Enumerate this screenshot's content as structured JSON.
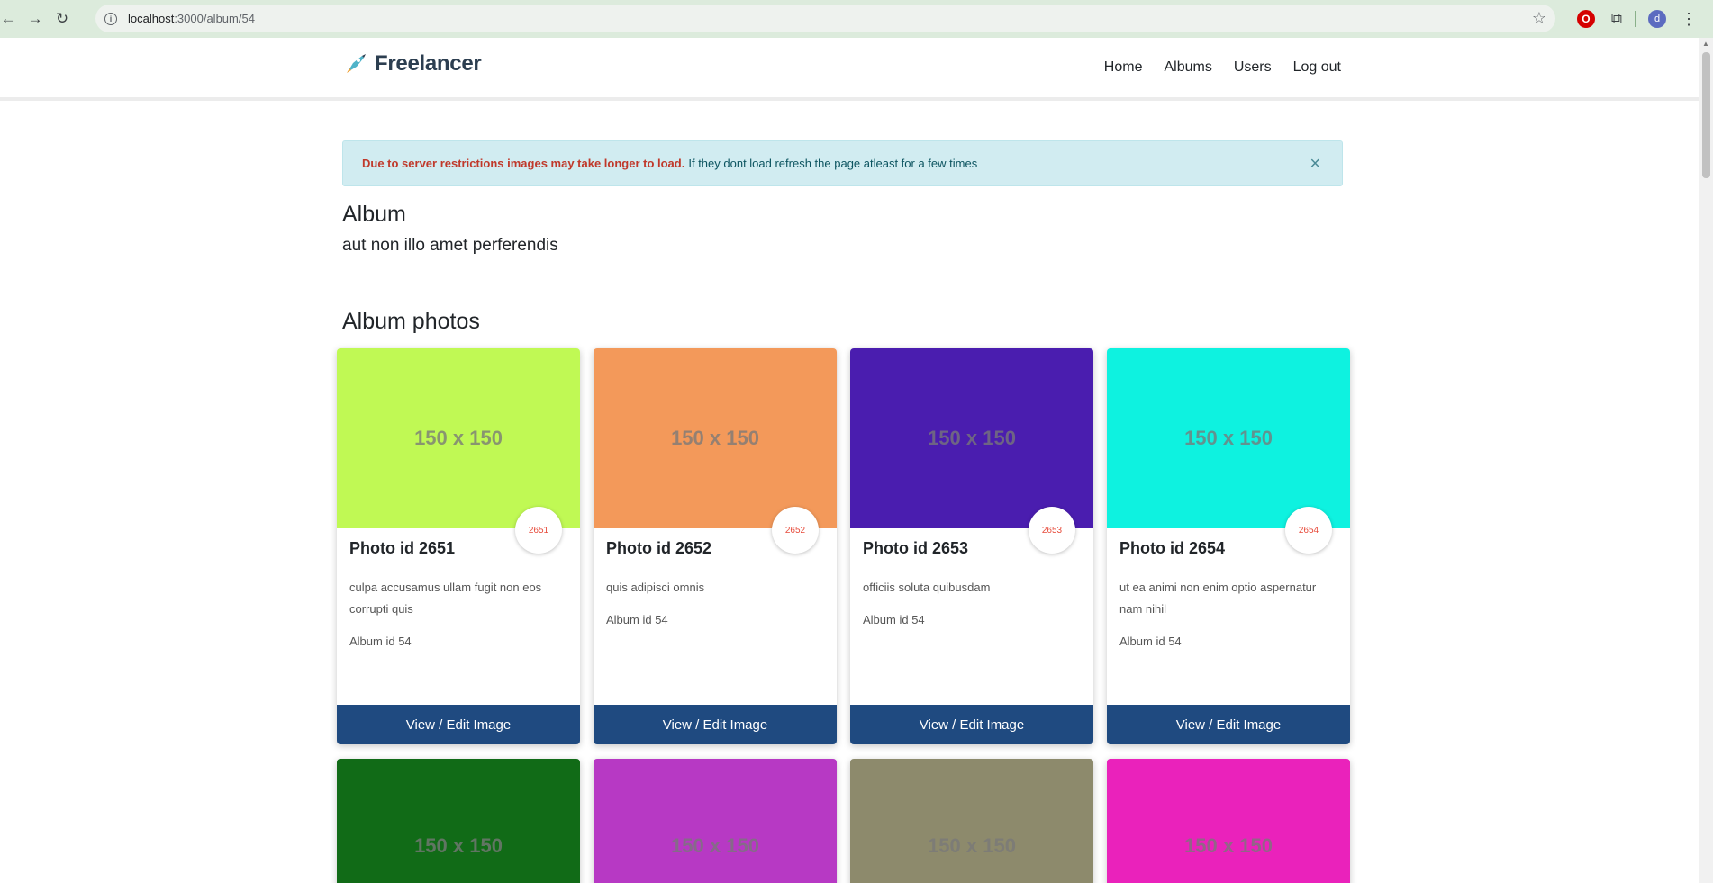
{
  "browser": {
    "url_host": "localhost",
    "url_path": ":3000/album/54",
    "avatar_letter": "d"
  },
  "navbar": {
    "brand": "Freelancer",
    "links": [
      "Home",
      "Albums",
      "Users",
      "Log out"
    ]
  },
  "alert": {
    "strong": "Due to server restrictions images may take longer to load.",
    "text": "If they dont load refresh the page atleast for a few times",
    "close": "×"
  },
  "album": {
    "heading": "Album",
    "title": "aut non illo amet perferendis",
    "photos_heading": "Album photos"
  },
  "photos": [
    {
      "placeholder": "150 x 150",
      "color": "#c0f954",
      "badge": "2651",
      "title": "Photo id 2651",
      "description": "culpa accusamus ullam fugit non eos corrupti quis",
      "album": "Album id 54",
      "button": "View / Edit Image"
    },
    {
      "placeholder": "150 x 150",
      "color": "#f3995a",
      "badge": "2652",
      "title": "Photo id 2652",
      "description": "quis adipisci omnis",
      "album": "Album id 54",
      "button": "View / Edit Image"
    },
    {
      "placeholder": "150 x 150",
      "color": "#4a1daf",
      "badge": "2653",
      "title": "Photo id 2653",
      "description": "officiis soluta quibusdam",
      "album": "Album id 54",
      "button": "View / Edit Image"
    },
    {
      "placeholder": "150 x 150",
      "color": "#0ef2e0",
      "badge": "2654",
      "title": "Photo id 2654",
      "description": "ut ea animi non enim optio aspernatur nam nihil",
      "album": "Album id 54",
      "button": "View / Edit Image"
    }
  ],
  "next_row": [
    {
      "placeholder": "150 x 150",
      "color": "#116b17"
    },
    {
      "placeholder": "150 x 150",
      "color": "#b739c4"
    },
    {
      "placeholder": "150 x 150",
      "color": "#8d8a6c"
    },
    {
      "placeholder": "150 x 150",
      "color": "#ea22bb"
    }
  ]
}
